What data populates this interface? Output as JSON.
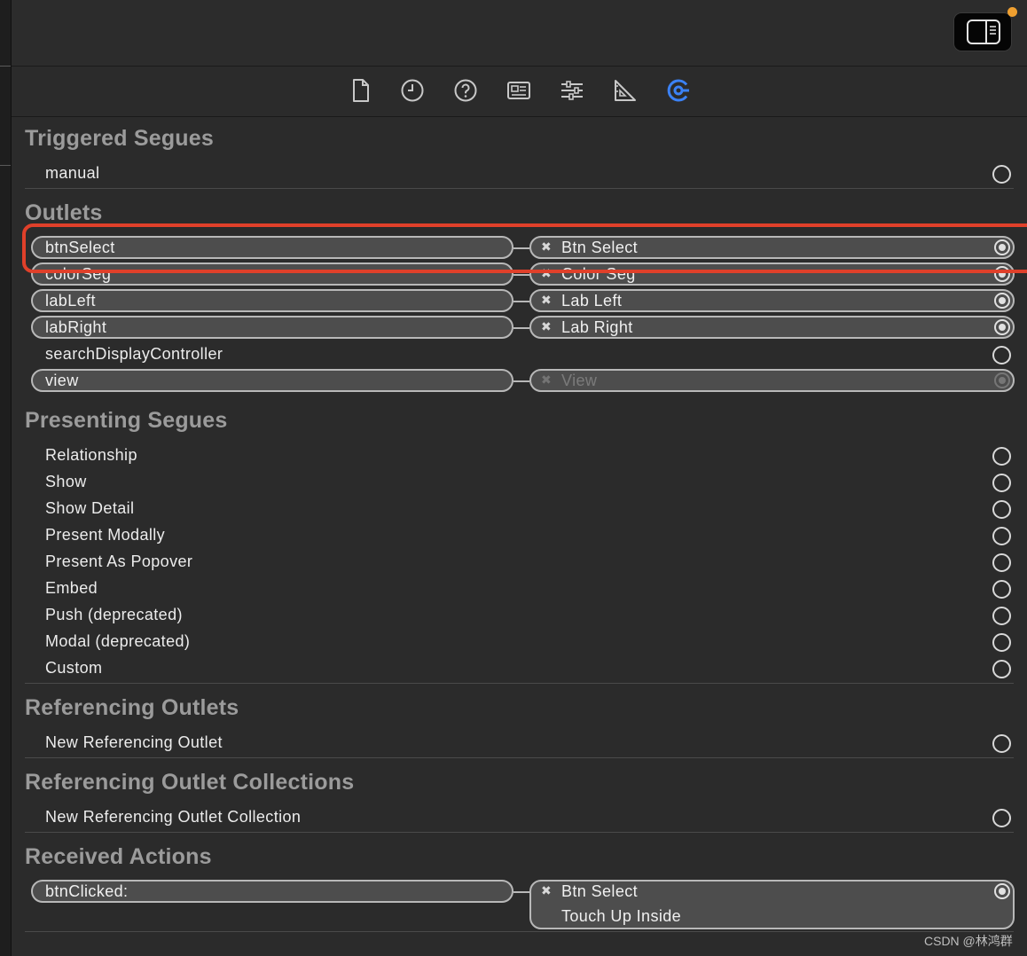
{
  "toolbar": {
    "icons": [
      "file-inspector-icon",
      "history-inspector-icon",
      "quick-help-icon",
      "identity-inspector-icon",
      "attributes-inspector-icon",
      "size-inspector-icon",
      "connections-inspector-icon"
    ],
    "active_color": "#3b82f6"
  },
  "sections": {
    "triggered_segues": {
      "title": "Triggered Segues",
      "items": [
        "manual"
      ]
    },
    "outlets": {
      "title": "Outlets",
      "items": [
        {
          "name": "btnSelect",
          "target": "Btn Select"
        },
        {
          "name": "colorSeg",
          "target": "Color Seg"
        },
        {
          "name": "labLeft",
          "target": "Lab Left"
        },
        {
          "name": "labRight",
          "target": "Lab Right"
        },
        {
          "name": "searchDisplayController"
        },
        {
          "name": "view",
          "target": "View"
        }
      ]
    },
    "presenting_segues": {
      "title": "Presenting Segues",
      "items": [
        "Relationship",
        "Show",
        "Show Detail",
        "Present Modally",
        "Present As Popover",
        "Embed",
        "Push (deprecated)",
        "Modal (deprecated)",
        "Custom"
      ]
    },
    "referencing_outlets": {
      "title": "Referencing Outlets",
      "items": [
        "New Referencing Outlet"
      ]
    },
    "referencing_outlet_collections": {
      "title": "Referencing Outlet Collections",
      "items": [
        "New Referencing Outlet Collection"
      ]
    },
    "received_actions": {
      "title": "Received Actions",
      "items": [
        {
          "name": "btnClicked:",
          "target": "Btn Select",
          "event": "Touch Up Inside"
        }
      ]
    }
  },
  "remove_glyph": "✖",
  "watermark": "CSDN @林鸿群",
  "highlight_color": "#e0402a"
}
